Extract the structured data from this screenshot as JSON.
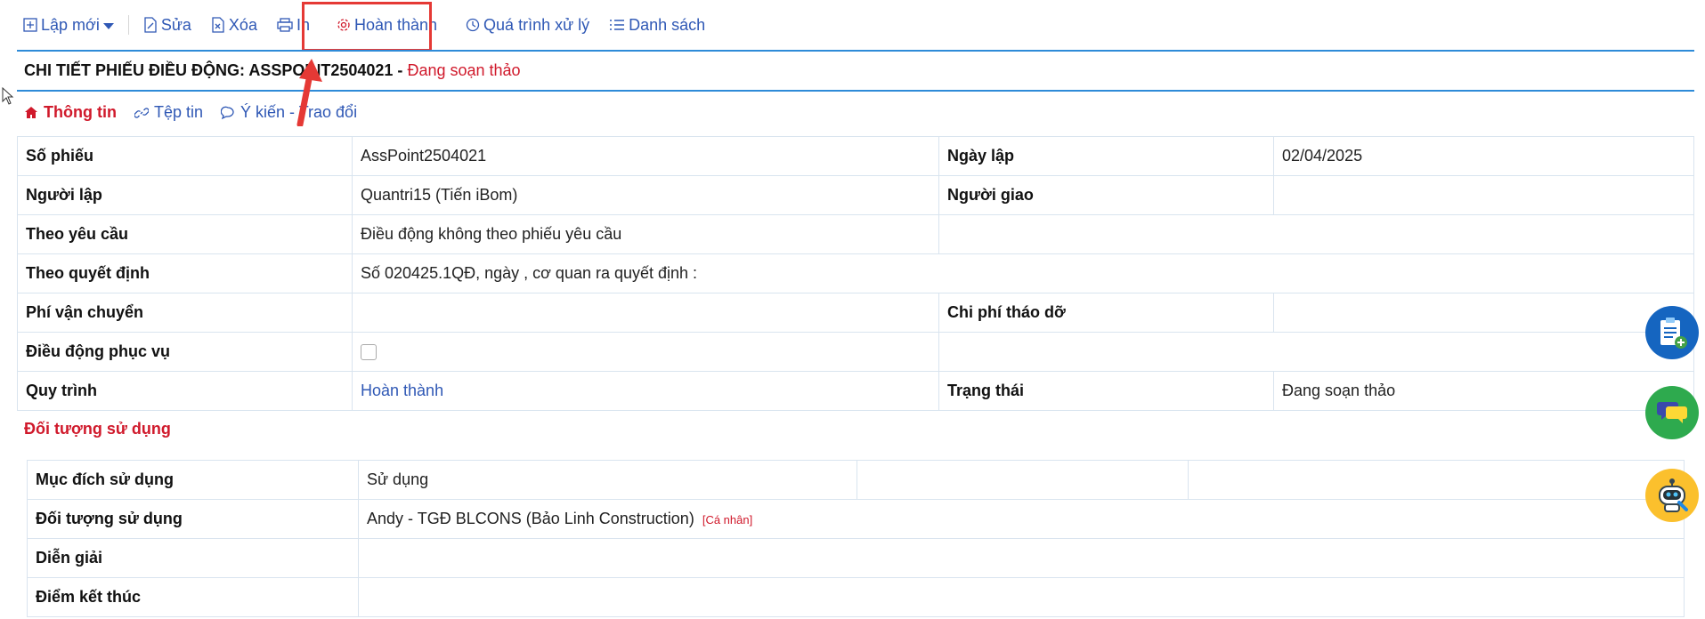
{
  "toolbar": {
    "new_label": "Lập mới",
    "edit_label": "Sửa",
    "delete_label": "Xóa",
    "print_label": "In",
    "complete_label": "Hoàn thành",
    "history_label": "Quá trình xử lý",
    "list_label": "Danh sách"
  },
  "header": {
    "title": "CHI TIẾT PHIẾU ĐIỀU ĐỘNG: ASSPOINT2504021 -",
    "status": "Đang soạn thảo"
  },
  "tabs": [
    {
      "label": "Thông tin",
      "icon": "home-icon"
    },
    {
      "label": "Tệp tin",
      "icon": "link-icon"
    },
    {
      "label": "Ý kiến - Trao đổi",
      "icon": "comment-icon"
    }
  ],
  "details": {
    "so_phieu_label": "Số phiếu",
    "so_phieu": "AssPoint2504021",
    "ngay_lap_label": "Ngày lập",
    "ngay_lap": "02/04/2025",
    "nguoi_lap_label": "Người lập",
    "nguoi_lap": "Quantri15 (Tiến iBom)",
    "nguoi_giao_label": "Người giao",
    "nguoi_giao": "",
    "theo_yeu_cau_label": "Theo yêu cầu",
    "theo_yeu_cau": "Điều động không theo phiếu yêu cầu",
    "theo_quyet_dinh_label": "Theo quyết định",
    "theo_quyet_dinh": "Số 020425.1QĐ, ngày , cơ quan ra quyết định :",
    "phi_van_chuyen_label": "Phí vận chuyển",
    "phi_van_chuyen": "",
    "chi_phi_thao_do_label": "Chi phí tháo dỡ",
    "chi_phi_thao_do": "",
    "dieu_dong_phuc_vu_label": "Điều động phục vụ",
    "dieu_dong_phuc_vu_checked": false,
    "quy_trinh_label": "Quy trình",
    "quy_trinh": "Hoàn thành",
    "trang_thai_label": "Trạng thái",
    "trang_thai": "Đang soạn thảo"
  },
  "usage": {
    "section_title": "Đối tượng sử dụng",
    "muc_dich_label": "Mục đích sử dụng",
    "muc_dich": "Sử dụng",
    "doi_tuong_label": "Đối tượng sử dụng",
    "doi_tuong": "Andy - TGĐ BLCONS (Bảo Linh Construction)",
    "doi_tuong_tag": "[Cá nhân]",
    "dien_giai_label": "Diễn giải",
    "dien_giai": "",
    "diem_ket_thuc_label": "Điểm kết thúc",
    "diem_ket_thuc": ""
  },
  "colors": {
    "accent_blue": "#2f58b5",
    "status_red": "#d0192b",
    "highlight_red": "#e53935",
    "rule_blue": "#2e8bd8"
  }
}
